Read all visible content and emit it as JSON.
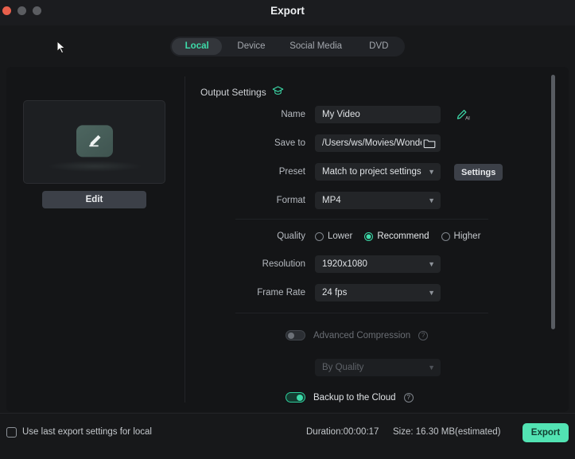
{
  "window": {
    "title": "Export",
    "controls": [
      "close",
      "minimize",
      "maximize"
    ]
  },
  "tabs": [
    {
      "label": "Local",
      "active": true
    },
    {
      "label": "Device",
      "active": false
    },
    {
      "label": "Social Media",
      "active": false
    },
    {
      "label": "DVD",
      "active": false
    }
  ],
  "preview": {
    "edit_button": "Edit",
    "icon": "pencil-edit-icon"
  },
  "output_settings": {
    "section_title": "Output Settings",
    "section_icon": "graduation-cap-icon",
    "name": {
      "label": "Name",
      "value": "My Video",
      "placeholder": "My Video",
      "ai_icon": "ai-pencil-icon"
    },
    "save_to": {
      "label": "Save to",
      "value": "/Users/ws/Movies/Wonder",
      "placeholder": "/Users/ws/Movies/Wonder",
      "folder_icon": "folder-icon"
    },
    "preset": {
      "label": "Preset",
      "value": "Match to project settings",
      "settings_button": "Settings"
    },
    "format": {
      "label": "Format",
      "value": "MP4"
    }
  },
  "quality_settings": {
    "quality": {
      "label": "Quality",
      "options": [
        {
          "label": "Lower",
          "selected": false
        },
        {
          "label": "Recommend",
          "selected": true
        },
        {
          "label": "Higher",
          "selected": false
        }
      ]
    },
    "resolution": {
      "label": "Resolution",
      "value": "1920x1080"
    },
    "frame_rate": {
      "label": "Frame Rate",
      "value": "24 fps"
    }
  },
  "advanced": {
    "compression": {
      "label": "Advanced Compression",
      "enabled": false,
      "help_icon": "help-circle-icon"
    },
    "compression_mode": {
      "value": "By Quality",
      "disabled": true
    },
    "backup": {
      "label": "Backup to the Cloud",
      "enabled": true,
      "help_icon": "help-circle-icon"
    }
  },
  "footer": {
    "use_last_settings": {
      "label": "Use last export settings for local",
      "checked": false
    },
    "duration": "Duration:00:00:17",
    "size": "Size: 16.30 MB(estimated)",
    "export_button": "Export"
  },
  "colors": {
    "accent_green": "#3ddcaa",
    "export_button": "#52e3b3",
    "window_bg": "#17181a",
    "card_bg": "#141517",
    "field_bg": "#232528"
  }
}
